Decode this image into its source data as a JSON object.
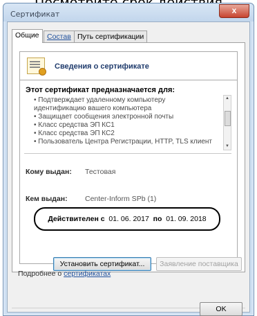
{
  "caption": "Посмотрите срок действия",
  "window": {
    "title": "Сертификат",
    "close_label": "x"
  },
  "tabs": [
    {
      "label": "Общие"
    },
    {
      "label": "Состав"
    },
    {
      "label": "Путь сертификации"
    }
  ],
  "info": {
    "header": "Сведения о сертификате",
    "purpose_title": "Этот сертификат предназначается для:",
    "purposes": [
      "• Подтверждает удаленному компьютеру",
      "идентификацию вашего компьютера",
      "• Защищает сообщения электронной почты",
      "• Класс средства ЭП КС1",
      "• Класс средства ЭП КС2",
      "• Пользователь Центра Регистрации, HTTP, TLS клиент"
    ],
    "issued_to_label": "Кому выдан:",
    "issued_to_value": "Тестовая",
    "issued_by_label": "Кем выдан:",
    "issued_by_value": "Center-Inform SPb (1)",
    "valid_from_label": "Действителен с",
    "valid_from_value": "01. 06. 2017",
    "valid_to_label": "по",
    "valid_to_value": "01. 09. 2018"
  },
  "buttons": {
    "install": "Установить сертификат...",
    "issuer_statement": "Заявление поставщика",
    "ok": "OK"
  },
  "more": {
    "prefix": "Подробнее о",
    "link": "сертификатах"
  }
}
